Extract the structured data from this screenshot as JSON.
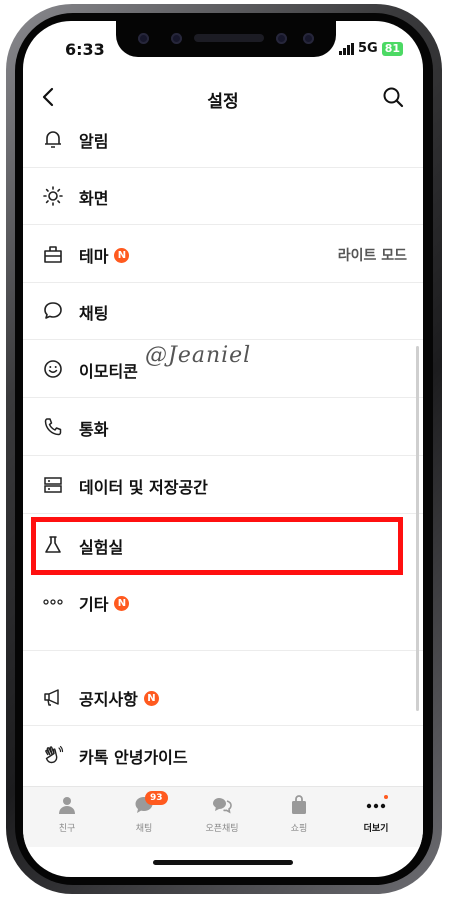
{
  "status_bar": {
    "time": "6:33",
    "network": "5G",
    "battery": "81"
  },
  "header": {
    "title": "설정"
  },
  "menu": {
    "items": [
      {
        "id": "alarm",
        "label": "알림",
        "icon": "bell-icon"
      },
      {
        "id": "display",
        "label": "화면",
        "icon": "sun-icon"
      },
      {
        "id": "theme",
        "label": "테마",
        "icon": "theme-icon",
        "badge": "N",
        "value": "라이트 모드"
      },
      {
        "id": "chat",
        "label": "채팅",
        "icon": "chat-bubble-icon"
      },
      {
        "id": "emoticon",
        "label": "이모티콘",
        "icon": "smiley-icon"
      },
      {
        "id": "call",
        "label": "통화",
        "icon": "phone-icon"
      },
      {
        "id": "data",
        "label": "데이터 및 저장공간",
        "icon": "storage-icon"
      },
      {
        "id": "lab",
        "label": "실험실",
        "icon": "flask-icon"
      },
      {
        "id": "etc",
        "label": "기타",
        "icon": "more-dots-icon",
        "badge": "N"
      },
      {
        "id": "notice",
        "label": "공지사항",
        "icon": "megaphone-icon",
        "badge": "N"
      },
      {
        "id": "guide",
        "label": "카톡 안녕가이드",
        "icon": "waving-hand-icon"
      }
    ]
  },
  "watermark": "@Jeaniel",
  "tabbar": {
    "tabs": [
      {
        "label": "친구",
        "icon": "person-icon"
      },
      {
        "label": "채팅",
        "icon": "chat-icon",
        "badge": "93"
      },
      {
        "label": "오픈채팅",
        "icon": "open-chat-icon"
      },
      {
        "label": "쇼핑",
        "icon": "shopping-bag-icon"
      },
      {
        "label": "더보기",
        "icon": "more-icon",
        "active": true
      }
    ]
  },
  "colors": {
    "badge": "#ff5a1f",
    "highlight": "#ff1010",
    "battery": "#4cd964"
  }
}
